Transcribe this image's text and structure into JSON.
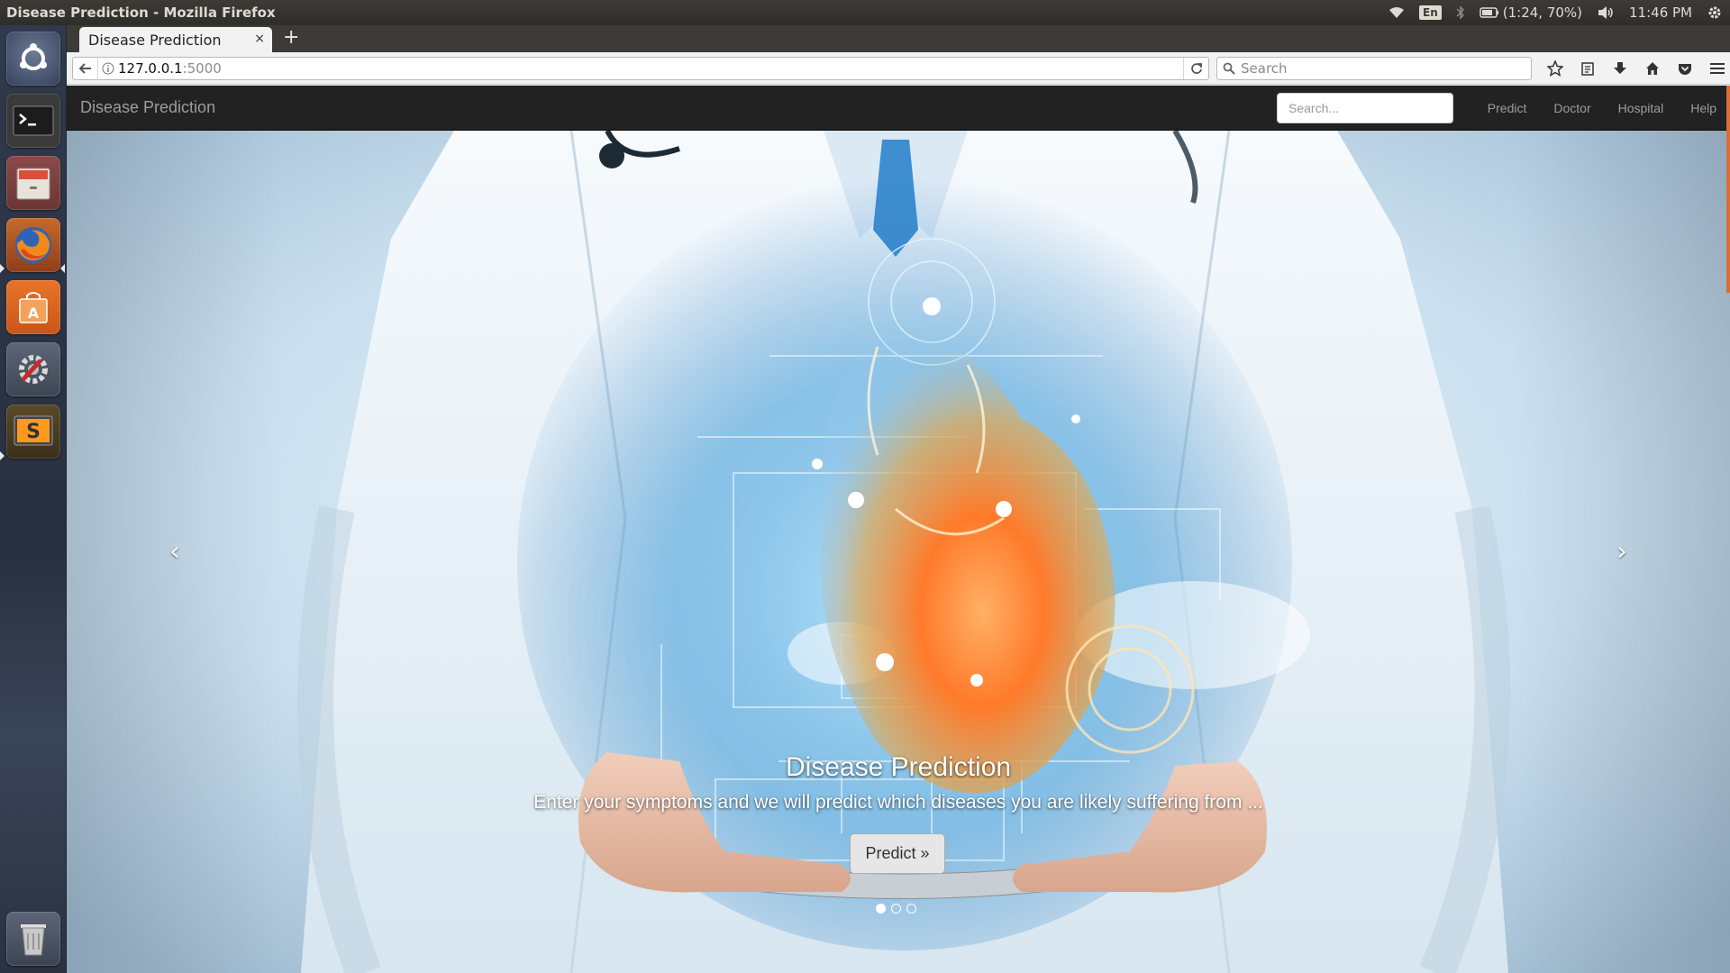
{
  "top_panel": {
    "window_title": "Disease Prediction - Mozilla Firefox",
    "keyboard_layout": "En",
    "battery": "(1:24, 70%)",
    "clock": "11:46 PM"
  },
  "launcher": {
    "items": [
      {
        "name": "ubuntu-dash",
        "icon": "ubuntu-logo-icon"
      },
      {
        "name": "terminal",
        "icon": "terminal-icon"
      },
      {
        "name": "files",
        "icon": "file-cabinet-icon"
      },
      {
        "name": "firefox",
        "icon": "firefox-icon",
        "active": true
      },
      {
        "name": "software-center",
        "icon": "shopping-bag-icon"
      },
      {
        "name": "system-settings",
        "icon": "gear-wrench-icon"
      },
      {
        "name": "sublime-text",
        "icon": "sublime-icon"
      },
      {
        "name": "trash",
        "icon": "trash-icon"
      }
    ]
  },
  "browser": {
    "tab_label": "Disease Prediction",
    "tab_close": "×",
    "new_tab": "+",
    "url_host": "127.0.0.1",
    "url_port": ":5000",
    "search_placeholder": "Search"
  },
  "site": {
    "brand": "Disease Prediction",
    "search_placeholder": "Search...",
    "nav_links": [
      "Predict",
      "Doctor",
      "Hospital",
      "Help"
    ]
  },
  "hero": {
    "title": "Disease Prediction",
    "subtitle": "Enter your symptoms and we will predict which diseases you are likely suffering from ...",
    "button_label": "Predict »",
    "prev_glyph": "‹",
    "next_glyph": "›",
    "slide_count": 3,
    "active_slide": 1
  },
  "colors": {
    "navbar_bg": "#222222",
    "navbar_text": "#9d9d9d",
    "panel_bg": "#3c3b37",
    "launcher_bg": "#2f3a4c"
  }
}
